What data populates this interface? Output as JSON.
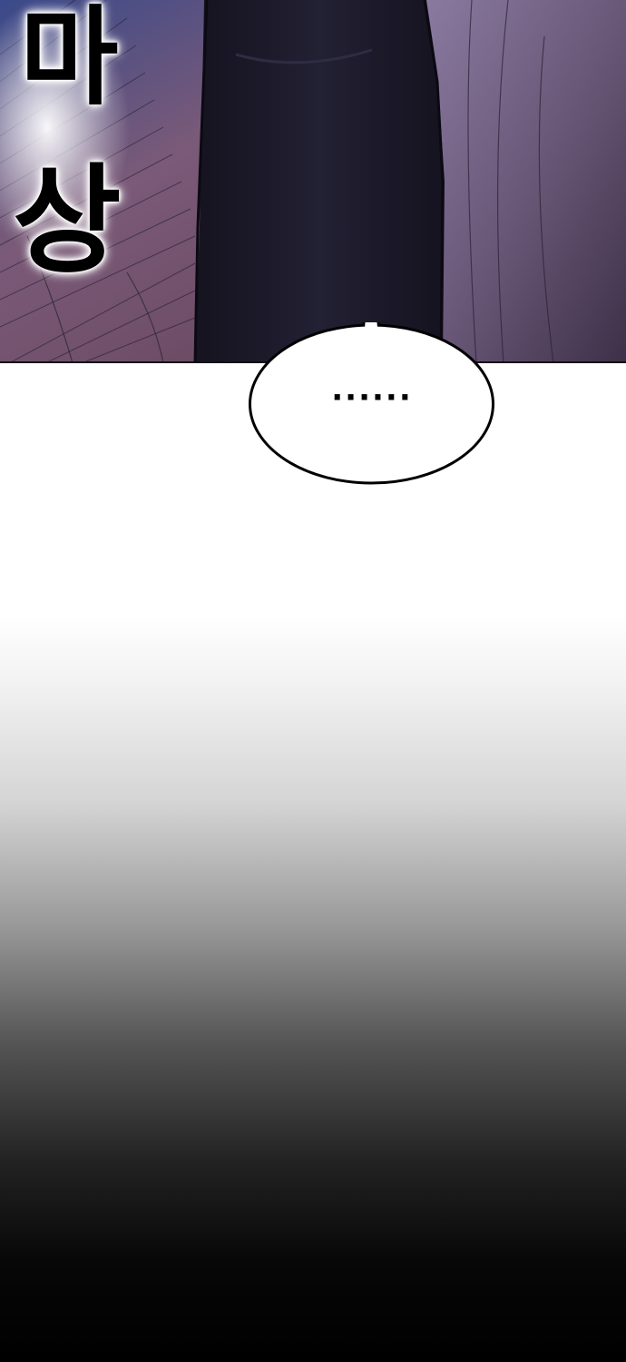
{
  "panel_top": {
    "sfx_lines": [
      "마",
      "상"
    ]
  },
  "speech_bubble": {
    "text": "······"
  },
  "colors": {
    "background_top": "#6b4a5e",
    "coat": "#1c1a2e",
    "ink": "#000000",
    "paper": "#ffffff"
  }
}
